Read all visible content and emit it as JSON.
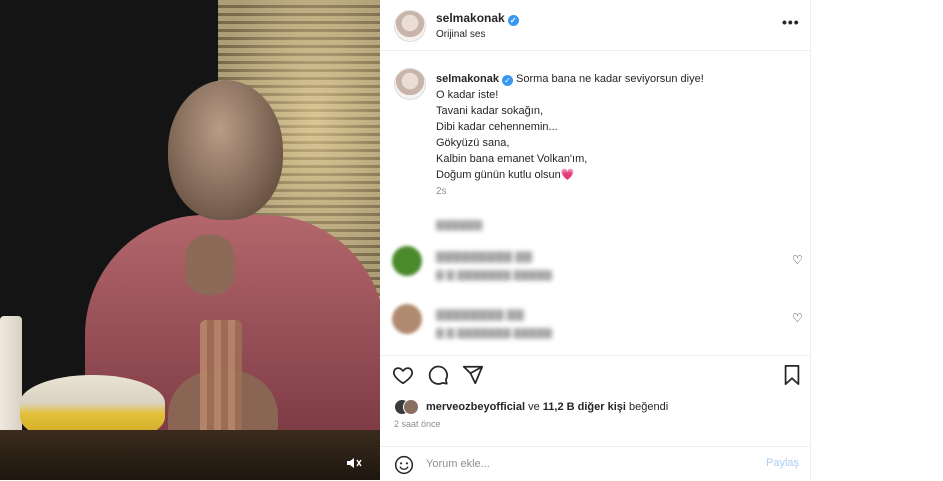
{
  "header": {
    "username": "selmakonak",
    "verified_icon": "verified-badge-icon",
    "subtitle": "Orijinal ses",
    "more_icon": "more-options-icon"
  },
  "caption": {
    "username": "selmakonak",
    "lines": [
      "Sorma bana ne kadar seviyorsun diye!",
      "O kadar iste!",
      "Tavani kadar sokağın,",
      "Dibi kadar cehennemin...",
      "Gökyüzü sana,",
      "Kalbin bana emanet Volkan'ım,",
      "Doğum günün kutlu olsun"
    ],
    "heart_emoji": "💗",
    "time": "2s"
  },
  "comments": [
    {
      "avatar_color": "#4a8a2c"
    },
    {
      "avatar_color": "#b08a6e"
    }
  ],
  "actions": {
    "like_icon": "heart-outline-icon",
    "comment_icon": "comment-bubble-icon",
    "share_icon": "paper-plane-icon",
    "save_icon": "bookmark-icon"
  },
  "likes": {
    "user": "merveozbeyofficial",
    "connector": "ve",
    "count": "11,2 B diğer kişi",
    "suffix": "beğendi"
  },
  "posted": "2 saat önce",
  "comment_box": {
    "placeholder": "Yorum ekle...",
    "post_label": "Paylaş",
    "emoji_icon": "smiley-icon"
  },
  "video": {
    "mute_icon": "speaker-muted-icon"
  },
  "colors": {
    "verified": "#3897f0",
    "text": "#262626",
    "secondary": "#8e8e8e",
    "post_button_disabled": "#a9cdf3"
  }
}
